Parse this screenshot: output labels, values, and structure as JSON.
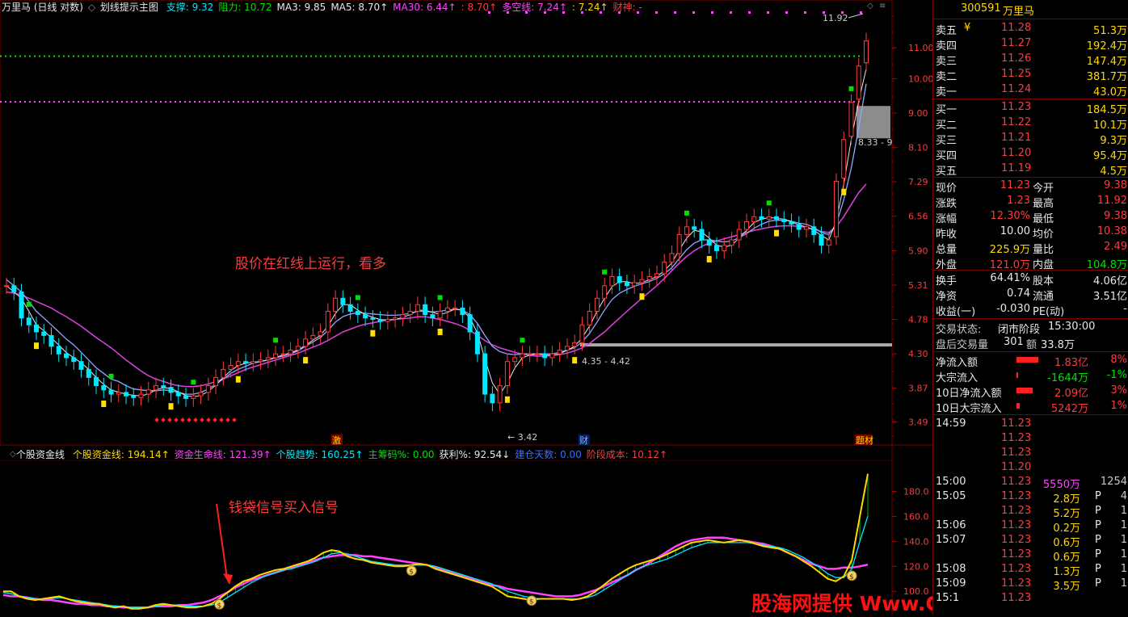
{
  "top_header": {
    "title": "万里马 (日线 对数)",
    "indicator_name": "划线提示主图",
    "items": [
      {
        "label": "支撑: 9.32",
        "color": "#00e8ff"
      },
      {
        "label": "阻力: 10.72",
        "color": "#00e000"
      },
      {
        "label": "MA3: 9.85",
        "color": "#e8e8e8"
      },
      {
        "label": "MA5: 8.70↑",
        "color": "#e8e8e8"
      },
      {
        "label": "MA30: 6.44↑",
        "color": "#ff44ff"
      },
      {
        "label": ": 8.70↑",
        "color": "#ff3b3b"
      },
      {
        "label": "多空线: 7.24↑",
        "color": "#ff44ff"
      },
      {
        "label": ": 7.24↑",
        "color": "#ffd800"
      },
      {
        "label": "财神: -",
        "color": "#ff3b3b"
      }
    ]
  },
  "sub_header": {
    "title": "个股资金线",
    "items": [
      {
        "label": "个股资金线: 194.14↑",
        "color": "#ffd800"
      },
      {
        "label": "资金生命线: 121.39↑",
        "color": "#ff44ff"
      },
      {
        "label": "个股趋势: 160.25↑",
        "color": "#00e8ff"
      },
      {
        "label": "主筹码%: 0.00",
        "color": "#00e000"
      },
      {
        "label": "获利%: 92.54↓",
        "color": "#e8e8e8"
      },
      {
        "label": "建仓天数: 0.00",
        "color": "#3a6bff"
      },
      {
        "label": "阶段成本: 10.12↑",
        "color": "#ff3b3b"
      }
    ]
  },
  "annotations": {
    "main_text": "股价在红线上运行，看多",
    "sub_text": "钱袋信号买入信号",
    "high_label": "11.92",
    "low_label": "3.42",
    "range_label_1": "4.35 - 4.42",
    "range_label_2": "8.33 - 9",
    "tag_1": "激",
    "tag_2": "财",
    "tag_3": "题材",
    "watermark": "股海网提供 Www.Guhai.Com.CN"
  },
  "chart_data": [
    {
      "type": "candlestick",
      "title": "划线提示主图",
      "y_ticks": [
        "11.00",
        "10.00",
        "9.00",
        "8.10",
        "7.29",
        "6.56",
        "5.90",
        "5.31",
        "4.78",
        "4.30",
        "3.87",
        "3.49"
      ],
      "scale": "log",
      "ylim": [
        3.3,
        12.3
      ],
      "close": [
        5.3,
        5.2,
        4.8,
        4.7,
        4.6,
        4.55,
        4.4,
        4.3,
        4.25,
        4.2,
        4.1,
        4.0,
        3.9,
        3.85,
        3.8,
        3.82,
        3.78,
        3.76,
        3.8,
        3.85,
        3.9,
        3.88,
        3.82,
        3.78,
        3.75,
        3.78,
        3.82,
        3.9,
        4.0,
        4.1,
        4.15,
        4.2,
        4.18,
        4.2,
        4.22,
        4.25,
        4.3,
        4.3,
        4.35,
        4.4,
        4.5,
        4.55,
        4.6,
        4.9,
        5.1,
        5.0,
        4.9,
        4.85,
        4.8,
        4.78,
        4.75,
        4.78,
        4.8,
        4.85,
        4.9,
        5.0,
        4.85,
        4.8,
        4.9,
        4.95,
        4.95,
        4.85,
        4.6,
        4.3,
        3.8,
        3.7,
        3.9,
        4.2,
        4.25,
        4.3,
        4.3,
        4.3,
        4.25,
        4.3,
        4.35,
        4.4,
        4.45,
        4.7,
        4.9,
        5.1,
        5.3,
        5.45,
        5.35,
        5.3,
        5.35,
        5.4,
        5.45,
        5.5,
        5.7,
        5.85,
        6.2,
        6.35,
        6.3,
        6.1,
        6.0,
        5.9,
        6.0,
        6.1,
        6.3,
        6.45,
        6.55,
        6.5,
        6.55,
        6.5,
        6.45,
        6.4,
        6.3,
        6.35,
        6.2,
        6.0,
        6.1,
        7.3,
        8.3,
        9.3,
        10.4,
        11.23
      ],
      "ma_blue": [
        5.4,
        5.3,
        5.2,
        5.05,
        4.9,
        4.8,
        4.7,
        4.6,
        4.5,
        4.42,
        4.32,
        4.22,
        4.12,
        4.05,
        3.98,
        3.95,
        3.9,
        3.86,
        3.85,
        3.84,
        3.84,
        3.85,
        3.84,
        3.82,
        3.8,
        3.8,
        3.82,
        3.86,
        3.92,
        3.98,
        4.05,
        4.1,
        4.14,
        4.18,
        4.2,
        4.22,
        4.25,
        4.27,
        4.3,
        4.34,
        4.4,
        4.46,
        4.52,
        4.62,
        4.74,
        4.82,
        4.86,
        4.88,
        4.87,
        4.86,
        4.85,
        4.84,
        4.84,
        4.85,
        4.87,
        4.9,
        4.9,
        4.89,
        4.9,
        4.92,
        4.93,
        4.92,
        4.85,
        4.72,
        4.55,
        4.4,
        4.33,
        4.3,
        4.29,
        4.3,
        4.3,
        4.3,
        4.3,
        4.3,
        4.32,
        4.35,
        4.38,
        4.46,
        4.58,
        4.74,
        4.92,
        5.08,
        5.18,
        5.24,
        5.29,
        5.33,
        5.37,
        5.42,
        5.5,
        5.6,
        5.76,
        5.92,
        6.04,
        6.1,
        6.1,
        6.08,
        6.06,
        6.08,
        6.14,
        6.22,
        6.32,
        6.4,
        6.46,
        6.48,
        6.48,
        6.46,
        6.42,
        6.4,
        6.34,
        6.24,
        6.2,
        6.4,
        6.9,
        7.6,
        8.6,
        9.85
      ],
      "ma_magenta": [
        5.2,
        5.18,
        5.15,
        5.1,
        5.05,
        5.0,
        4.95,
        4.88,
        4.82,
        4.75,
        4.68,
        4.6,
        4.52,
        4.45,
        4.38,
        4.3,
        4.22,
        4.15,
        4.08,
        4.02,
        3.98,
        3.95,
        3.92,
        3.9,
        3.89,
        3.89,
        3.9,
        3.92,
        3.95,
        3.98,
        4.02,
        4.06,
        4.1,
        4.13,
        4.16,
        4.19,
        4.22,
        4.25,
        4.28,
        4.31,
        4.35,
        4.39,
        4.43,
        4.48,
        4.54,
        4.6,
        4.64,
        4.68,
        4.71,
        4.73,
        4.75,
        4.77,
        4.78,
        4.79,
        4.8,
        4.82,
        4.82,
        4.8,
        4.78,
        4.75,
        4.72,
        4.68,
        4.62,
        4.55,
        4.48,
        4.42,
        4.38,
        4.35,
        4.32,
        4.3,
        4.28,
        4.27,
        4.27,
        4.28,
        4.29,
        4.31,
        4.34,
        4.38,
        4.44,
        4.52,
        4.6,
        4.7,
        4.8,
        4.9,
        5.0,
        5.1,
        5.2,
        5.3,
        5.42,
        5.55,
        5.68,
        5.8,
        5.9,
        5.98,
        6.04,
        6.08,
        6.12,
        6.16,
        6.2,
        6.24,
        6.28,
        6.31,
        6.34,
        6.36,
        6.37,
        6.37,
        6.36,
        6.34,
        6.3,
        6.26,
        6.24,
        6.35,
        6.55,
        6.8,
        7.05,
        7.24
      ]
    },
    {
      "type": "line",
      "title": "个股资金线",
      "y_ticks": [
        "180.0",
        "160.0",
        "140.0",
        "120.0",
        "100.0"
      ],
      "ylim": [
        82,
        203
      ],
      "series": [
        {
          "name": "个股资金线",
          "color": "#ffd800",
          "values": [
            100,
            100,
            96,
            94,
            93,
            94,
            95,
            96,
            94,
            92,
            91,
            90,
            90,
            88,
            87,
            88,
            86,
            86,
            87,
            89,
            90,
            89,
            88,
            87,
            87,
            88,
            90,
            94,
            99,
            104,
            108,
            110,
            113,
            115,
            117,
            118,
            120,
            122,
            124,
            127,
            131,
            133,
            132,
            128,
            126,
            125,
            123,
            122,
            121,
            120,
            120,
            121,
            122,
            121,
            118,
            116,
            114,
            112,
            110,
            108,
            106,
            104,
            100,
            96,
            95,
            94,
            93,
            94,
            94,
            94,
            94,
            93,
            94,
            96,
            100,
            105,
            110,
            114,
            118,
            121,
            123,
            125,
            127,
            130,
            133,
            136,
            139,
            140,
            141,
            140,
            139,
            140,
            141,
            140,
            138,
            136,
            135,
            134,
            131,
            128,
            124,
            120,
            115,
            110,
            108,
            112,
            125,
            160,
            194.14
          ]
        },
        {
          "name": "资金生命线",
          "color": "#ff44ff",
          "values": [
            97,
            96,
            96,
            95,
            94,
            93,
            93,
            92,
            91,
            90,
            90,
            89,
            89,
            88,
            88,
            87,
            87,
            87,
            87,
            88,
            88,
            88,
            89,
            89,
            90,
            91,
            93,
            96,
            99,
            103,
            106,
            109,
            111,
            113,
            115,
            117,
            119,
            121,
            123,
            125,
            127,
            128,
            129,
            129,
            129,
            128,
            128,
            127,
            126,
            125,
            124,
            123,
            122,
            121,
            119,
            117,
            115,
            113,
            111,
            109,
            107,
            105,
            104,
            102,
            101,
            100,
            99,
            98,
            97,
            96,
            96,
            96,
            97,
            99,
            101,
            104,
            107,
            110,
            113,
            117,
            120,
            124,
            128,
            132,
            136,
            139,
            141,
            142,
            143,
            143,
            143,
            142,
            141,
            140,
            139,
            138,
            136,
            134,
            131,
            128,
            125,
            122,
            120,
            118,
            118,
            119,
            119,
            120,
            121.39
          ]
        },
        {
          "name": "个股趋势",
          "color": "#00e8ff",
          "values": [
            99,
            98,
            96,
            95,
            94,
            94,
            94,
            95,
            94,
            93,
            92,
            91,
            90,
            89,
            88,
            88,
            87,
            87,
            87,
            88,
            89,
            89,
            89,
            88,
            88,
            88,
            89,
            91,
            95,
            99,
            103,
            107,
            110,
            113,
            115,
            117,
            118,
            120,
            122,
            124,
            127,
            130,
            131,
            130,
            128,
            126,
            124,
            123,
            122,
            121,
            121,
            121,
            121,
            121,
            120,
            118,
            116,
            114,
            112,
            110,
            108,
            106,
            103,
            100,
            98,
            96,
            95,
            94,
            94,
            94,
            94,
            94,
            94,
            95,
            97,
            101,
            105,
            109,
            113,
            117,
            120,
            122,
            124,
            126,
            129,
            132,
            135,
            137,
            139,
            139,
            139,
            139,
            139,
            139,
            138,
            137,
            136,
            135,
            133,
            130,
            127,
            123,
            119,
            114,
            111,
            111,
            118,
            140,
            160.25
          ]
        }
      ]
    }
  ],
  "panel": {
    "code": "300591",
    "name": "万里马",
    "asks": [
      {
        "label": "卖五",
        "extra": "¥",
        "price": "11.28",
        "vol": "51.3万"
      },
      {
        "label": "卖四",
        "extra": "",
        "price": "11.27",
        "vol": "192.4万"
      },
      {
        "label": "卖三",
        "extra": "",
        "price": "11.26",
        "vol": "147.4万"
      },
      {
        "label": "卖二",
        "extra": "",
        "price": "11.25",
        "vol": "381.7万"
      },
      {
        "label": "卖一",
        "extra": "",
        "price": "11.24",
        "vol": "43.0万"
      }
    ],
    "bids": [
      {
        "label": "买一",
        "price": "11.23",
        "vol": "184.5万"
      },
      {
        "label": "买二",
        "price": "11.22",
        "vol": "10.1万"
      },
      {
        "label": "买三",
        "price": "11.21",
        "vol": "9.3万"
      },
      {
        "label": "买四",
        "price": "11.20",
        "vol": "95.4万"
      },
      {
        "label": "买五",
        "price": "11.19",
        "vol": "4.5万"
      }
    ],
    "quote": [
      {
        "l1": "现价",
        "v1": "11.23",
        "c1": "red",
        "l2": "今开",
        "v2": "9.38",
        "c2": "red"
      },
      {
        "l1": "涨跌",
        "v1": "1.23",
        "c1": "red",
        "l2": "最高",
        "v2": "11.92",
        "c2": "red"
      },
      {
        "l1": "涨幅",
        "v1": "12.30%",
        "c1": "red",
        "l2": "最低",
        "v2": "9.38",
        "c2": "red"
      },
      {
        "l1": "昨收",
        "v1": "10.00",
        "c1": "white",
        "l2": "均价",
        "v2": "10.38",
        "c2": "red"
      },
      {
        "l1": "总量",
        "v1": "225.9万",
        "c1": "yellow",
        "l2": "量比",
        "v2": "2.49",
        "c2": "red"
      },
      {
        "l1": "外盘",
        "v1": "121.0万",
        "c1": "red",
        "l2": "内盘",
        "v2": "104.8万",
        "c2": "green"
      }
    ],
    "stats": [
      {
        "l1": "换手",
        "v1": "64.41%",
        "l2": "股本",
        "v2": "4.06亿"
      },
      {
        "l1": "净资",
        "v1": "0.74",
        "l2": "流通",
        "v2": "3.51亿"
      },
      {
        "l1": "收益(一)",
        "v1": "-0.030",
        "l2": "PE(动)",
        "v2": "-"
      }
    ],
    "status": {
      "label": "交易状态:",
      "value": "闭市阶段",
      "time": "15:30:00"
    },
    "after": {
      "label": "盘后交易量",
      "vol": "301",
      "amt_label": "额",
      "amt": "33.8万"
    },
    "flows": [
      {
        "label": "净流入额",
        "value": "1.83亿",
        "pct": "8%",
        "bar": 0.8,
        "vcolor": "#ff3b3b"
      },
      {
        "label": "大宗流入",
        "value": "-1644万",
        "pct": "-1%",
        "bar": 0.03,
        "vcolor": "#00e000"
      },
      {
        "label": "10日净流入额",
        "value": "2.09亿",
        "pct": "3%",
        "bar": 0.6,
        "vcolor": "#ff3b3b"
      },
      {
        "label": "10日大宗流入",
        "value": "5242万",
        "pct": "1%",
        "bar": 0.12,
        "vcolor": "#ff3b3b"
      }
    ],
    "ticks": [
      {
        "time": "14:59",
        "price": "11.23",
        "vol": "",
        "flag": "",
        "n": ""
      },
      {
        "time": "",
        "price": "11.23",
        "vol": "",
        "flag": "",
        "n": ""
      },
      {
        "time": "",
        "price": "11.23",
        "vol": "",
        "flag": "",
        "n": ""
      },
      {
        "time": "",
        "price": "11.20",
        "vol": "",
        "flag": "",
        "n": ""
      },
      {
        "time": "15:00",
        "price": "11.23",
        "vol": "5550万",
        "flag": "",
        "n": "1254"
      },
      {
        "time": "15:05",
        "price": "11.23",
        "vol": "2.8万",
        "flag": "P",
        "n": "4"
      },
      {
        "time": "",
        "price": "11.23",
        "vol": "5.2万",
        "flag": "P",
        "n": "1"
      },
      {
        "time": "15:06",
        "price": "11.23",
        "vol": "0.2万",
        "flag": "P",
        "n": "1"
      },
      {
        "time": "15:07",
        "price": "11.23",
        "vol": "0.6万",
        "flag": "P",
        "n": "1"
      },
      {
        "time": "",
        "price": "11.23",
        "vol": "0.6万",
        "flag": "P",
        "n": "1"
      },
      {
        "time": "15:08",
        "price": "11.23",
        "vol": "1.3万",
        "flag": "P",
        "n": "1"
      },
      {
        "time": "15:09",
        "price": "11.23",
        "vol": "3.5万",
        "flag": "P",
        "n": "1"
      },
      {
        "time": "15:1",
        "price": "11.23",
        "vol": "",
        "flag": "",
        "n": ""
      }
    ]
  }
}
